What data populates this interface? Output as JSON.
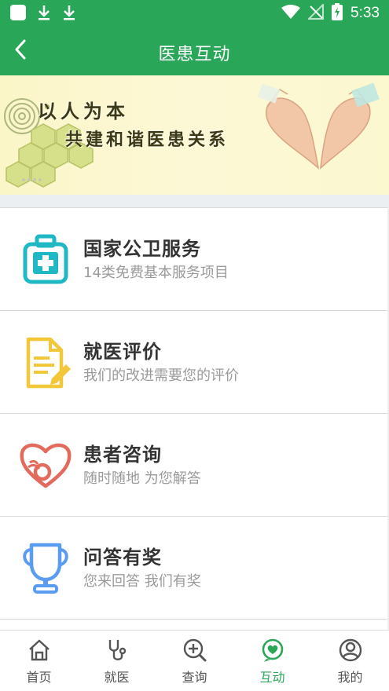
{
  "status_bar": {
    "time": "5:33"
  },
  "header": {
    "title": "医患互动",
    "back_icon": "chevron-left-icon"
  },
  "banner": {
    "line1": "以人为本",
    "line2": "共建和谐医患关系"
  },
  "menu": [
    {
      "title": "国家公卫服务",
      "subtitle": "14类免费基本服务项目",
      "icon": "medical-kit-icon",
      "color": "#20b8c4"
    },
    {
      "title": "就医评价",
      "subtitle": "我们的改进需要您的评价",
      "icon": "document-edit-icon",
      "color": "#f2c739"
    },
    {
      "title": "患者咨询",
      "subtitle": "随时随地 为您解答",
      "icon": "heart-stethoscope-icon",
      "color": "#e26b5d"
    },
    {
      "title": "问答有奖",
      "subtitle": "您来回答 我们有奖",
      "icon": "trophy-icon",
      "color": "#5b9cf0"
    }
  ],
  "tabs": [
    {
      "label": "首页",
      "icon": "home-icon"
    },
    {
      "label": "就医",
      "icon": "stethoscope-icon"
    },
    {
      "label": "查询",
      "icon": "search-plus-icon"
    },
    {
      "label": "互动",
      "icon": "heart-chat-icon",
      "active": true
    },
    {
      "label": "我的",
      "icon": "user-icon"
    }
  ],
  "colors": {
    "primary": "#2aa658",
    "tab_inactive": "#555555"
  }
}
